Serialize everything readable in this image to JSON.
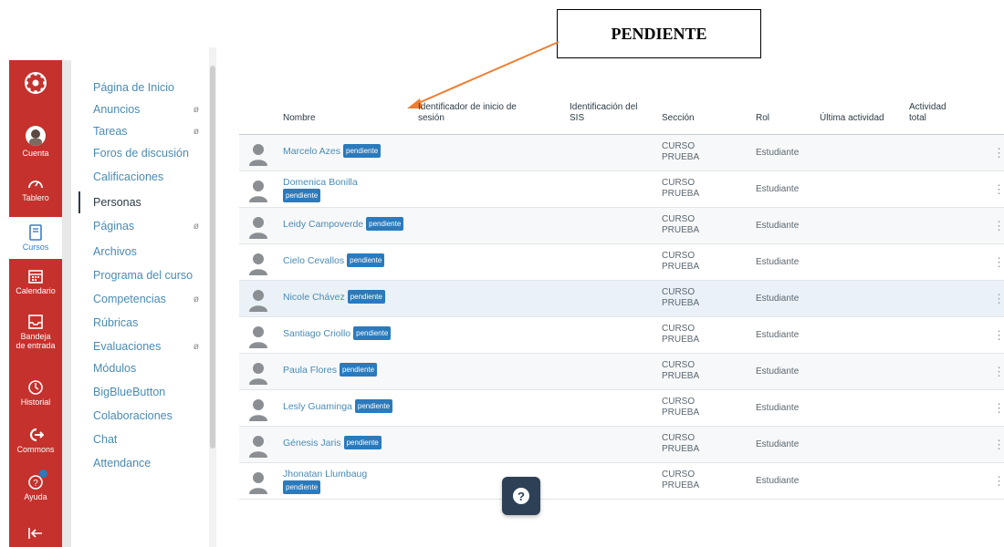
{
  "annotation": {
    "label": "PENDIENTE"
  },
  "global_nav": {
    "items": [
      {
        "label": "Cuenta",
        "icon": "avatar"
      },
      {
        "label": "Tablero",
        "icon": "speedometer-icon"
      },
      {
        "label": "Cursos",
        "icon": "book-icon"
      },
      {
        "label": "Calendario",
        "icon": "calendar-icon"
      },
      {
        "label_line1": "Bandeja",
        "label_line2": "de entrada",
        "icon": "inbox-icon"
      },
      {
        "label": "Historial",
        "icon": "clock-icon"
      },
      {
        "label": "Commons",
        "icon": "commons-icon"
      },
      {
        "label": "Ayuda",
        "icon": "help-icon"
      }
    ],
    "colors": {
      "background": "#c5312c",
      "active": "#ffffff"
    }
  },
  "course_nav": {
    "items": [
      {
        "label": "Página de Inicio",
        "hidden_icon": ""
      },
      {
        "label": "Anuncios",
        "hidden_icon": "ø"
      },
      {
        "label": "Tareas",
        "hidden_icon": "ø"
      },
      {
        "label": "Foros de discusión",
        "hidden_icon": ""
      },
      {
        "label": "Calificaciones",
        "hidden_icon": ""
      },
      {
        "label": "Personas",
        "hidden_icon": ""
      },
      {
        "label": "Páginas",
        "hidden_icon": "ø"
      },
      {
        "label": "Archivos",
        "hidden_icon": ""
      },
      {
        "label": "Programa del curso",
        "hidden_icon": ""
      },
      {
        "label": "Competencias",
        "hidden_icon": "ø"
      },
      {
        "label": "Rúbricas",
        "hidden_icon": ""
      },
      {
        "label": "Evaluaciones",
        "hidden_icon": "ø"
      },
      {
        "label": "Módulos",
        "hidden_icon": ""
      },
      {
        "label": "BigBlueButton",
        "hidden_icon": ""
      },
      {
        "label": "Colaboraciones",
        "hidden_icon": ""
      },
      {
        "label": "Chat",
        "hidden_icon": ""
      },
      {
        "label": "Attendance",
        "hidden_icon": ""
      }
    ],
    "active": "Personas"
  },
  "table": {
    "headers": {
      "name": "Nombre",
      "login_line1": "Identificador de inicio de",
      "login_line2": "sesión",
      "sis_line1": "Identificación del",
      "sis_line2": "SIS",
      "section": "Sección",
      "role": "Rol",
      "last_activity": "Última actividad",
      "total_line1": "Actividad",
      "total_line2": "total"
    },
    "badge": "pendiente",
    "rows": [
      {
        "name": "Marcelo Azes",
        "section_line1": "CURSO",
        "section_line2": "PRUEBA",
        "role": "Estudiante"
      },
      {
        "name": "Domenica Bonilla",
        "section_line1": "CURSO",
        "section_line2": "PRUEBA",
        "role": "Estudiante"
      },
      {
        "name": "Leidy Campoverde",
        "section_line1": "CURSO",
        "section_line2": "PRUEBA",
        "role": "Estudiante"
      },
      {
        "name": "Cielo Cevallos",
        "section_line1": "CURSO",
        "section_line2": "PRUEBA",
        "role": "Estudiante"
      },
      {
        "name": "Nicole Chávez",
        "section_line1": "CURSO",
        "section_line2": "PRUEBA",
        "role": "Estudiante"
      },
      {
        "name": "Santiago Criollo",
        "section_line1": "CURSO",
        "section_line2": "PRUEBA",
        "role": "Estudiante"
      },
      {
        "name": "Paula Flores",
        "section_line1": "CURSO",
        "section_line2": "PRUEBA",
        "role": "Estudiante"
      },
      {
        "name": "Lesly Guaminga",
        "section_line1": "CURSO",
        "section_line2": "PRUEBA",
        "role": "Estudiante"
      },
      {
        "name": "Génesis Jaris",
        "section_line1": "CURSO",
        "section_line2": "PRUEBA",
        "role": "Estudiante"
      },
      {
        "name": "Jhonatan Llumbaug",
        "section_line1": "CURSO",
        "section_line2": "PRUEBA",
        "role": "Estudiante"
      }
    ]
  },
  "help_button": {
    "icon": "question-icon",
    "label": "?"
  }
}
